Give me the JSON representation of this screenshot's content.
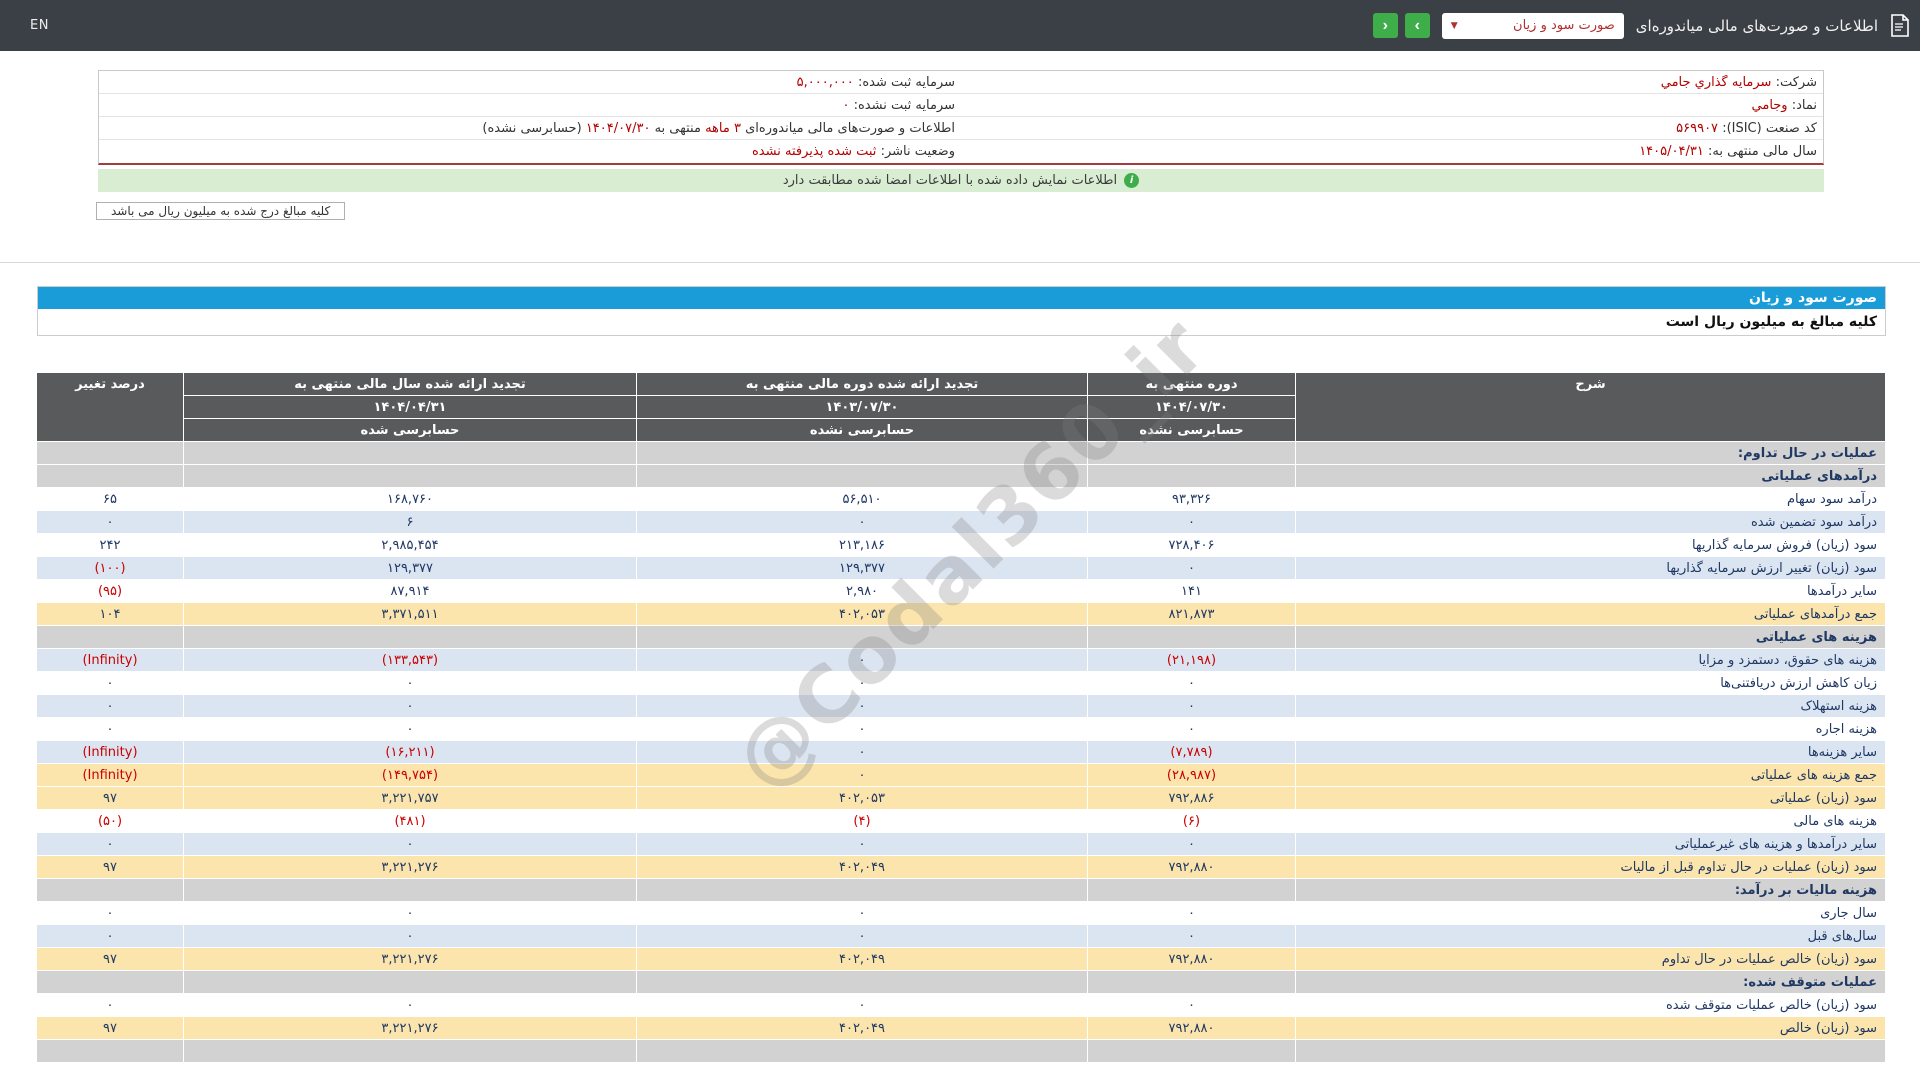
{
  "top_bar": {
    "en": "EN",
    "title": "اطلاعات و صورت‌های مالی میاندوره‌ای",
    "report_select": "صورت سود و زیان",
    "next_arrow": "‹",
    "prev_arrow": "›"
  },
  "company_info": {
    "rows": [
      {
        "r_label": "شرکت:",
        "r_value": "سرمایه گذاري جامي",
        "l_label": "سرمایه ثبت شده:",
        "l_value": "۵,۰۰۰,۰۰۰"
      },
      {
        "r_label": "نماد:",
        "r_value": "وجامي",
        "l_label": "سرمایه ثبت نشده:",
        "l_value": "۰"
      },
      {
        "r_label": "کد صنعت (ISIC):",
        "r_value": "۵۶۹۹۰۷"
      },
      {
        "r_label": "سال مالی منتهی به:",
        "r_value": "۱۴۰۵/۰۴/۳۱",
        "l_label": "وضعیت ناشر:",
        "l_value": "ثبت شده پذیرفته نشده"
      }
    ],
    "period_line": {
      "part1": "اطلاعات و صورت‌های مالی میاندوره‌ای",
      "highlight1": "۳ ماهه",
      "part2": "منتهی به",
      "highlight2": "۱۴۰۴/۰۷/۳۰",
      "part3": "(حسابرسی نشده)"
    }
  },
  "notice": {
    "text": "اطلاعات نمایش داده شده با اطلاعات امضا شده مطابقت دارد",
    "icon": "i"
  },
  "units_note": "کلیه مبالغ درج شده به میلیون ریال می باشد",
  "statement": {
    "title": "صورت سود و زیان",
    "units": "کلیه مبالغ به میلیون ریال است"
  },
  "table": {
    "headers": {
      "desc": "شرح",
      "col1_title": "دوره منتهی به",
      "col1_date": "۱۴۰۴/۰۷/۳۰",
      "col1_audit": "حسابرسی نشده",
      "col2_title": "تجدید ارائه شده دوره مالی منتهی به",
      "col2_date": "۱۴۰۳/۰۷/۳۰",
      "col2_audit": "حسابرسی نشده",
      "col3_title": "تجدید ارائه شده سال مالی منتهی به",
      "col3_date": "۱۴۰۴/۰۴/۳۱",
      "col3_audit": "حسابرسی شده",
      "change": "درصد تغییر"
    },
    "rows": [
      {
        "type": "section",
        "label": "عملیات در حال تداوم:",
        "values": [
          "",
          "",
          "",
          ""
        ]
      },
      {
        "type": "section",
        "label": "درآمدهای عملیاتی",
        "values": [
          "",
          "",
          "",
          ""
        ]
      },
      {
        "type": "white",
        "label": "درآمد سود سهام",
        "values": [
          "۹۳,۳۲۶",
          "۵۶,۵۱۰",
          "۱۶۸,۷۶۰",
          "۶۵"
        ]
      },
      {
        "type": "blue",
        "label": "درآمد سود تضمین شده",
        "values": [
          "۰",
          "۰",
          "۶",
          "۰"
        ]
      },
      {
        "type": "white",
        "label": "سود (زیان) فروش سرمایه گذاریها",
        "values": [
          "۷۲۸,۴۰۶",
          "۲۱۳,۱۸۶",
          "۲,۹۸۵,۴۵۴",
          "۲۴۲"
        ]
      },
      {
        "type": "blue",
        "label": "سود (زیان) تغییر ارزش سرمایه گذاریها",
        "values": [
          "۰",
          "۱۲۹,۳۷۷",
          "۱۲۹,۳۷۷",
          "(۱۰۰)"
        ]
      },
      {
        "type": "white",
        "label": "سایر درآمدها",
        "values": [
          "۱۴۱",
          "۲,۹۸۰",
          "۸۷,۹۱۴",
          "(۹۵)"
        ]
      },
      {
        "type": "total",
        "label": "جمع درآمدهای عملیاتی",
        "values": [
          "۸۲۱,۸۷۳",
          "۴۰۲,۰۵۳",
          "۳,۳۷۱,۵۱۱",
          "۱۰۴"
        ]
      },
      {
        "type": "section",
        "label": "هزینه های عملیاتی",
        "values": [
          "",
          "",
          "",
          ""
        ]
      },
      {
        "type": "blue",
        "label": "هزینه های حقوق، دستمزد و مزایا",
        "values": [
          "(۲۱,۱۹۸)",
          "۰",
          "(۱۳۳,۵۴۳)",
          "(Infinity)"
        ]
      },
      {
        "type": "white",
        "label": "زیان کاهش ارزش دریافتنی‌ها",
        "values": [
          "۰",
          "۰",
          "۰",
          "۰"
        ]
      },
      {
        "type": "blue",
        "label": "هزینه استهلاک",
        "values": [
          "۰",
          "۰",
          "۰",
          "۰"
        ]
      },
      {
        "type": "white",
        "label": "هزینه اجاره",
        "values": [
          "۰",
          "۰",
          "۰",
          "۰"
        ]
      },
      {
        "type": "blue",
        "label": "سایر هزینه‌ها",
        "values": [
          "(۷,۷۸۹)",
          "۰",
          "(۱۶,۲۱۱)",
          "(Infinity)"
        ]
      },
      {
        "type": "total",
        "label": "جمع هزینه های عملیاتی",
        "values": [
          "(۲۸,۹۸۷)",
          "۰",
          "(۱۴۹,۷۵۴)",
          "(Infinity)"
        ]
      },
      {
        "type": "total",
        "label": "سود (زیان) عملیاتی",
        "values": [
          "۷۹۲,۸۸۶",
          "۴۰۲,۰۵۳",
          "۳,۲۲۱,۷۵۷",
          "۹۷"
        ]
      },
      {
        "type": "white",
        "label": "هزینه های مالی",
        "values": [
          "(۶)",
          "(۴)",
          "(۴۸۱)",
          "(۵۰)"
        ]
      },
      {
        "type": "blue",
        "label": "سایر درآمدها و هزینه های غیرعملیاتی",
        "values": [
          "۰",
          "۰",
          "۰",
          "۰"
        ]
      },
      {
        "type": "total",
        "label": "سود (زیان) عملیات در حال تداوم قبل از مالیات",
        "values": [
          "۷۹۲,۸۸۰",
          "۴۰۲,۰۴۹",
          "۳,۲۲۱,۲۷۶",
          "۹۷"
        ]
      },
      {
        "type": "section",
        "label": "هزینه مالیات بر درآمد:",
        "values": [
          "",
          "",
          "",
          ""
        ]
      },
      {
        "type": "white",
        "label": "سال جاری",
        "values": [
          "۰",
          "۰",
          "۰",
          "۰"
        ]
      },
      {
        "type": "blue",
        "label": "سال‌های قبل",
        "values": [
          "۰",
          "۰",
          "۰",
          "۰"
        ]
      },
      {
        "type": "total",
        "label": "سود (زیان) خالص عملیات در حال تداوم",
        "values": [
          "۷۹۲,۸۸۰",
          "۴۰۲,۰۴۹",
          "۳,۲۲۱,۲۷۶",
          "۹۷"
        ]
      },
      {
        "type": "section",
        "label": "عملیات متوقف شده:",
        "values": [
          "",
          "",
          "",
          ""
        ]
      },
      {
        "type": "white",
        "label": "سود (زیان) خالص عملیات متوقف شده",
        "values": [
          "۰",
          "۰",
          "۰",
          "۰"
        ]
      },
      {
        "type": "total",
        "label": "سود (زیان) خالص",
        "values": [
          "۷۹۲,۸۸۰",
          "۴۰۲,۰۴۹",
          "۳,۲۲۱,۲۷۶",
          "۹۷"
        ]
      },
      {
        "type": "section",
        "label": "",
        "values": [
          "",
          "",
          "",
          ""
        ]
      }
    ]
  },
  "watermark": "@Codal360_ir",
  "colors": {
    "topbar": "#3b4046",
    "accent_blue": "#1a9cd8",
    "button_green": "#3fae4a",
    "notice_green_bg": "#d9edd3",
    "info_value_red": "#b30000",
    "negative_red": "#cc0000",
    "header_gray": "#595a5c",
    "section_row_gray": "#d2d2d2",
    "blue_row": "#dbe5f1",
    "total_row_yellow": "#fbe5ac",
    "text_navy": "#1f3864"
  }
}
